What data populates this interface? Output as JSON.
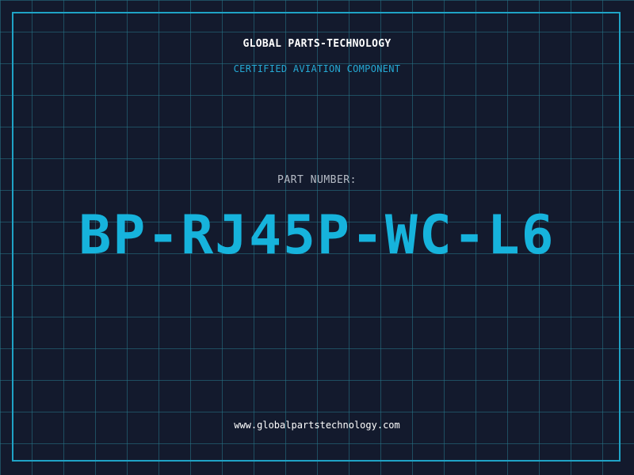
{
  "header": {
    "company_name": "GLOBAL PARTS-TECHNOLOGY",
    "subtitle": "CERTIFIED AVIATION COMPONENT"
  },
  "main": {
    "part_label": "PART NUMBER:",
    "part_number": "BP-RJ45P-WC-L6"
  },
  "footer": {
    "website": "www.globalpartstechnology.com"
  },
  "colors": {
    "background": "#131a2d",
    "grid": "#26768a",
    "accent": "#16b3dc",
    "frame": "#1fa3c6"
  }
}
